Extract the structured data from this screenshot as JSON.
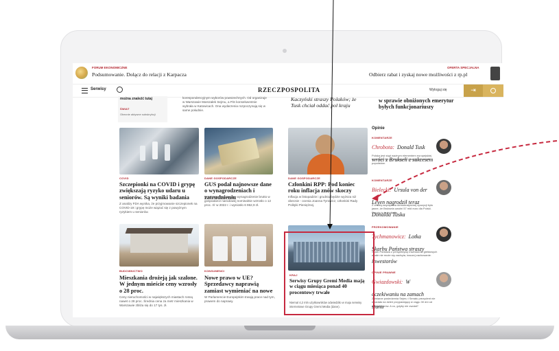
{
  "topbar": {
    "left_label": "FORUM EKONOMICZNE",
    "left_title": "Podsumowanie. Dołącz do relacji z Karpacza",
    "right_label": "OFERTA SPECJALNA",
    "right_title": "Odbierz rabat i zyskaj nowe możliwości z rp.pl"
  },
  "nav": {
    "menu_label": "Serwisy",
    "logo": "RZECZPOSPOLITA",
    "search_icon": "search-icon",
    "right_label": "Wyloguj się"
  },
  "top_row": {
    "left_text": "można znaleźć tutaj",
    "left_tag": "ŚWIAT",
    "left_small": "Obecnie aktywne subskrybcji",
    "center_small": "korespondencyjnym wyborów powszechnych. Od organizuje w Warszawie Marszałek Sejmu, a PiS konsekwentnie wybrała w Katowicach. Ona wydarzenia rozpoczynają się w same południe.",
    "mid_title": "Kaczyński straszy Polaków; że Tusk chciał oddać pol kraju",
    "right_title": "w sprawie obniżonych emerytur byłych funkcjonariuszy"
  },
  "articles": [
    {
      "tag": "COVID",
      "title": "Szczepionki na COVID i grypę zwiększają ryzyko udaru u seniorów. Są wyniki badania",
      "desc": "Z analizy FDA wynika, że przyjmowanie szczepionek na COVID-19 i grypę może wiązać się z powyżnym ryzykiem u seniorów."
    },
    {
      "tag": "DANE GOSPODARCZE",
      "title": "GUS podał najnowsze dane o wynagrodzeniach i zatrudnieniu",
      "desc": "Przeciętne miesięczne wynagrodzenie brutto w gospodarce narodowej nominalnie wzrosło o 12 proc. r/r w 2022 r. i wyniosło 6 962,9 zł."
    },
    {
      "tag": "DANE GOSPODARCZE",
      "title": "Członkini RPP: Pod koniec roku inflacja znów skoczy",
      "desc": "Inflacja w listopadzie i grudniu będzie wyższa niż obecnie - ocenia Joanna Tyrowicz, członkini Rady Polityki Pieniężnej."
    },
    {
      "tag": "BUDOWNICTWO",
      "title": "Mieszkania drożeją jak szalone. W jednym mieście ceny wzrosły o 28 proc.",
      "desc": "Ceny nieruchomości w największych miastach rosną nawet o 28 proc. Średnia cena za metr mieszkania w Warszawie zbliża się do 17 tys. zł."
    },
    {
      "tag": "KONSUMENCI",
      "title": "Nowe prawo w UE? Sprzedawcy naprawią zamiast wymieniać na nowe",
      "desc": "W Parlamencie Europejskim trwają prace nad tym, prawem do naprawy."
    },
    {
      "tag": "KRAJ",
      "title": "Serwisy Grupy Gremi Media mają w ciągu miesiąca ponad 40 procentowy trwałe",
      "desc": "Niemal 4,2 mln użytkowników odwiedziło w maju serwisy internetowe Grupy Gremi Media (dane)."
    }
  ],
  "opinions": {
    "header": "Opinie",
    "items": [
      {
        "tag": "KOMENTARZE",
        "author": "Chrobota:",
        "title": "Donald Tusk wróci z Brukseli z sukcesem",
        "desc": "Polska jest stąd ważnym elementem europejskiej układanki, by nie negocjować pozycji pokonanie populistów."
      },
      {
        "tag": "KOMENTARZE",
        "author": "Bielecki:",
        "title": "Ursula von der Leyen nagrodził teraz Donalda Tuska",
        "desc": "Z chwilą zwycięstwa demokratycznej opozycji było jasne, że Bruksela uwolni 57 mld euro dla Polski. Reszta to technikalia."
      },
      {
        "tag": "PRZEKOMOWANIE",
        "author": "Tychmanowicz:",
        "title": "Lotka Skarbu Państwa straszy inwestorów",
        "desc": "Skarb Państwa z perspektywy inwestorów giełdowych wcale nie może się zachęta, inaczej zachowanie."
      },
      {
        "tag": "OPINIE PRAWNE",
        "author": "Gwiazdowski:",
        "title": "W oczekiwaniu na zamach stanu",
        "desc": "Zamiarze posiedzenia Sejmu i Senatu prezydent nie wpadała na dzień przypadający w ciągu 30 dni od dnia wyborów. A co, gdyby nie zwołał?"
      }
    ]
  },
  "colors": {
    "accent": "#c6283e",
    "brand": "#c8a24a",
    "opinion_red": "#c0303a"
  }
}
